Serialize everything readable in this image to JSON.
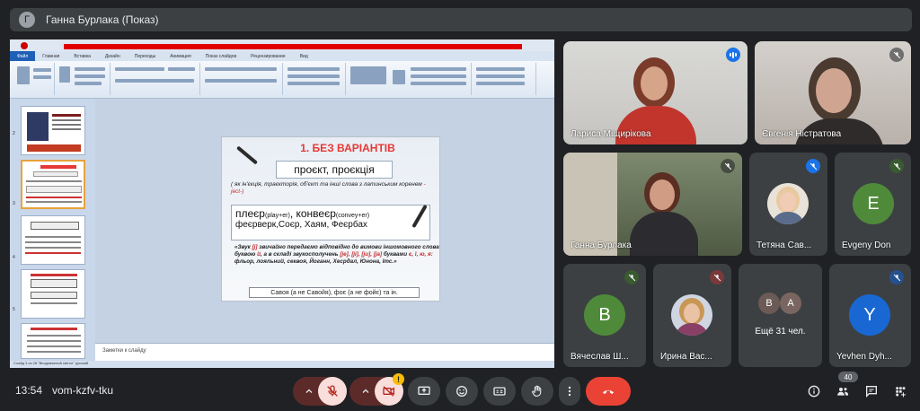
{
  "presenter": {
    "initial": "Г",
    "label": "Ганна Бурлака (Показ)"
  },
  "ppt": {
    "tabs": [
      "Файл",
      "Главная",
      "Вставка",
      "Дизайн",
      "Переходы",
      "Анимация",
      "Показ слайдов",
      "Рецензирование",
      "Вид"
    ],
    "notes_placeholder": "Заметки к слайду",
    "status": "Слайд 3 из 28   \"Вподовжений світло\"   русский"
  },
  "slide": {
    "title": "1. БЕЗ ВАРІАНТІВ",
    "box1": "проєкт, проєкція",
    "note_prefix": "( як ін",
    "note_mid": "'єкція, траєкторія, об'єкт та інші слова з латинським коренем ",
    "note_root": "-ject-)",
    "line1a": "плеєр",
    "line1b": "(play+er)",
    "line1c": ", конвеєр",
    "line1d": "(convey+er)",
    "line2": "феєрверк,Соєр, Хаям, Феєрбах",
    "rule_a": "«Звук ",
    "rule_j": "[j]",
    "rule_b": " звичайно передаємо відповідно до вимови іншомовного слова буквою ",
    "rule_y": "й",
    "rule_c": ", а в складі звукосполучень ",
    "rule_sounds": "[je], [ji], [ju], [ja]",
    "rule_d": " буквами ",
    "rule_letters": "є, ї, ю, я:",
    "rule_e": " фльор, лояльний, секвоя, Йоганн, Хесрдал, Юнона, Ітс.»",
    "bottom": "Савоя (а не Савойя), фоє (а не фойє) та ін."
  },
  "participants": [
    {
      "name": "Лариса Міщирікова"
    },
    {
      "name": "Євгенія Ністратова"
    },
    {
      "name": "Ганна Бурлака"
    },
    {
      "name": "Тетяна Сав..."
    },
    {
      "name": "Evgeny Don",
      "initial": "E"
    },
    {
      "name": "Вячеслав Ш...",
      "initial": "В"
    },
    {
      "name": "Ирина Вас..."
    },
    {
      "name": "Ещё 31 чел.",
      "initials": [
        "B",
        "A"
      ]
    },
    {
      "name": "Yevhen Dyh...",
      "initial": "Y"
    }
  ],
  "meeting": {
    "time": "13:54",
    "code": "vom-kzfv-tku",
    "people_count": "40",
    "warning": "!"
  },
  "colors": {
    "end_call": "#ea4335",
    "muted_btn": "#f9dedc",
    "muted_icon": "#b3261e",
    "speaking": "#1a73e8"
  }
}
